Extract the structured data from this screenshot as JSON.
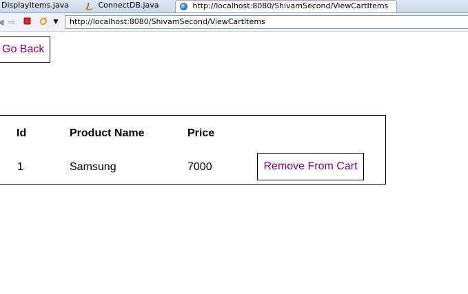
{
  "tabs": [
    {
      "label": "DisplayItems.java",
      "icon": "java-file-icon"
    },
    {
      "label": "ConnectDB.java",
      "icon": "java-file-icon"
    },
    {
      "label": "http://localhost:8080/ShivamSecond/ViewCartItems",
      "icon": "globe-icon",
      "active": true
    }
  ],
  "toolbar": {
    "url": "http://localhost:8080/ShivamSecond/ViewCartItems"
  },
  "page": {
    "go_back_label": "Go Back",
    "table": {
      "headers": [
        "Id",
        "Product Name",
        "Price"
      ],
      "rows": [
        {
          "id": "1",
          "name": "Samsung",
          "price": "7000",
          "action_label": "Remove From Cart"
        }
      ]
    }
  },
  "colors": {
    "link": "#800080",
    "border": "#000000"
  }
}
